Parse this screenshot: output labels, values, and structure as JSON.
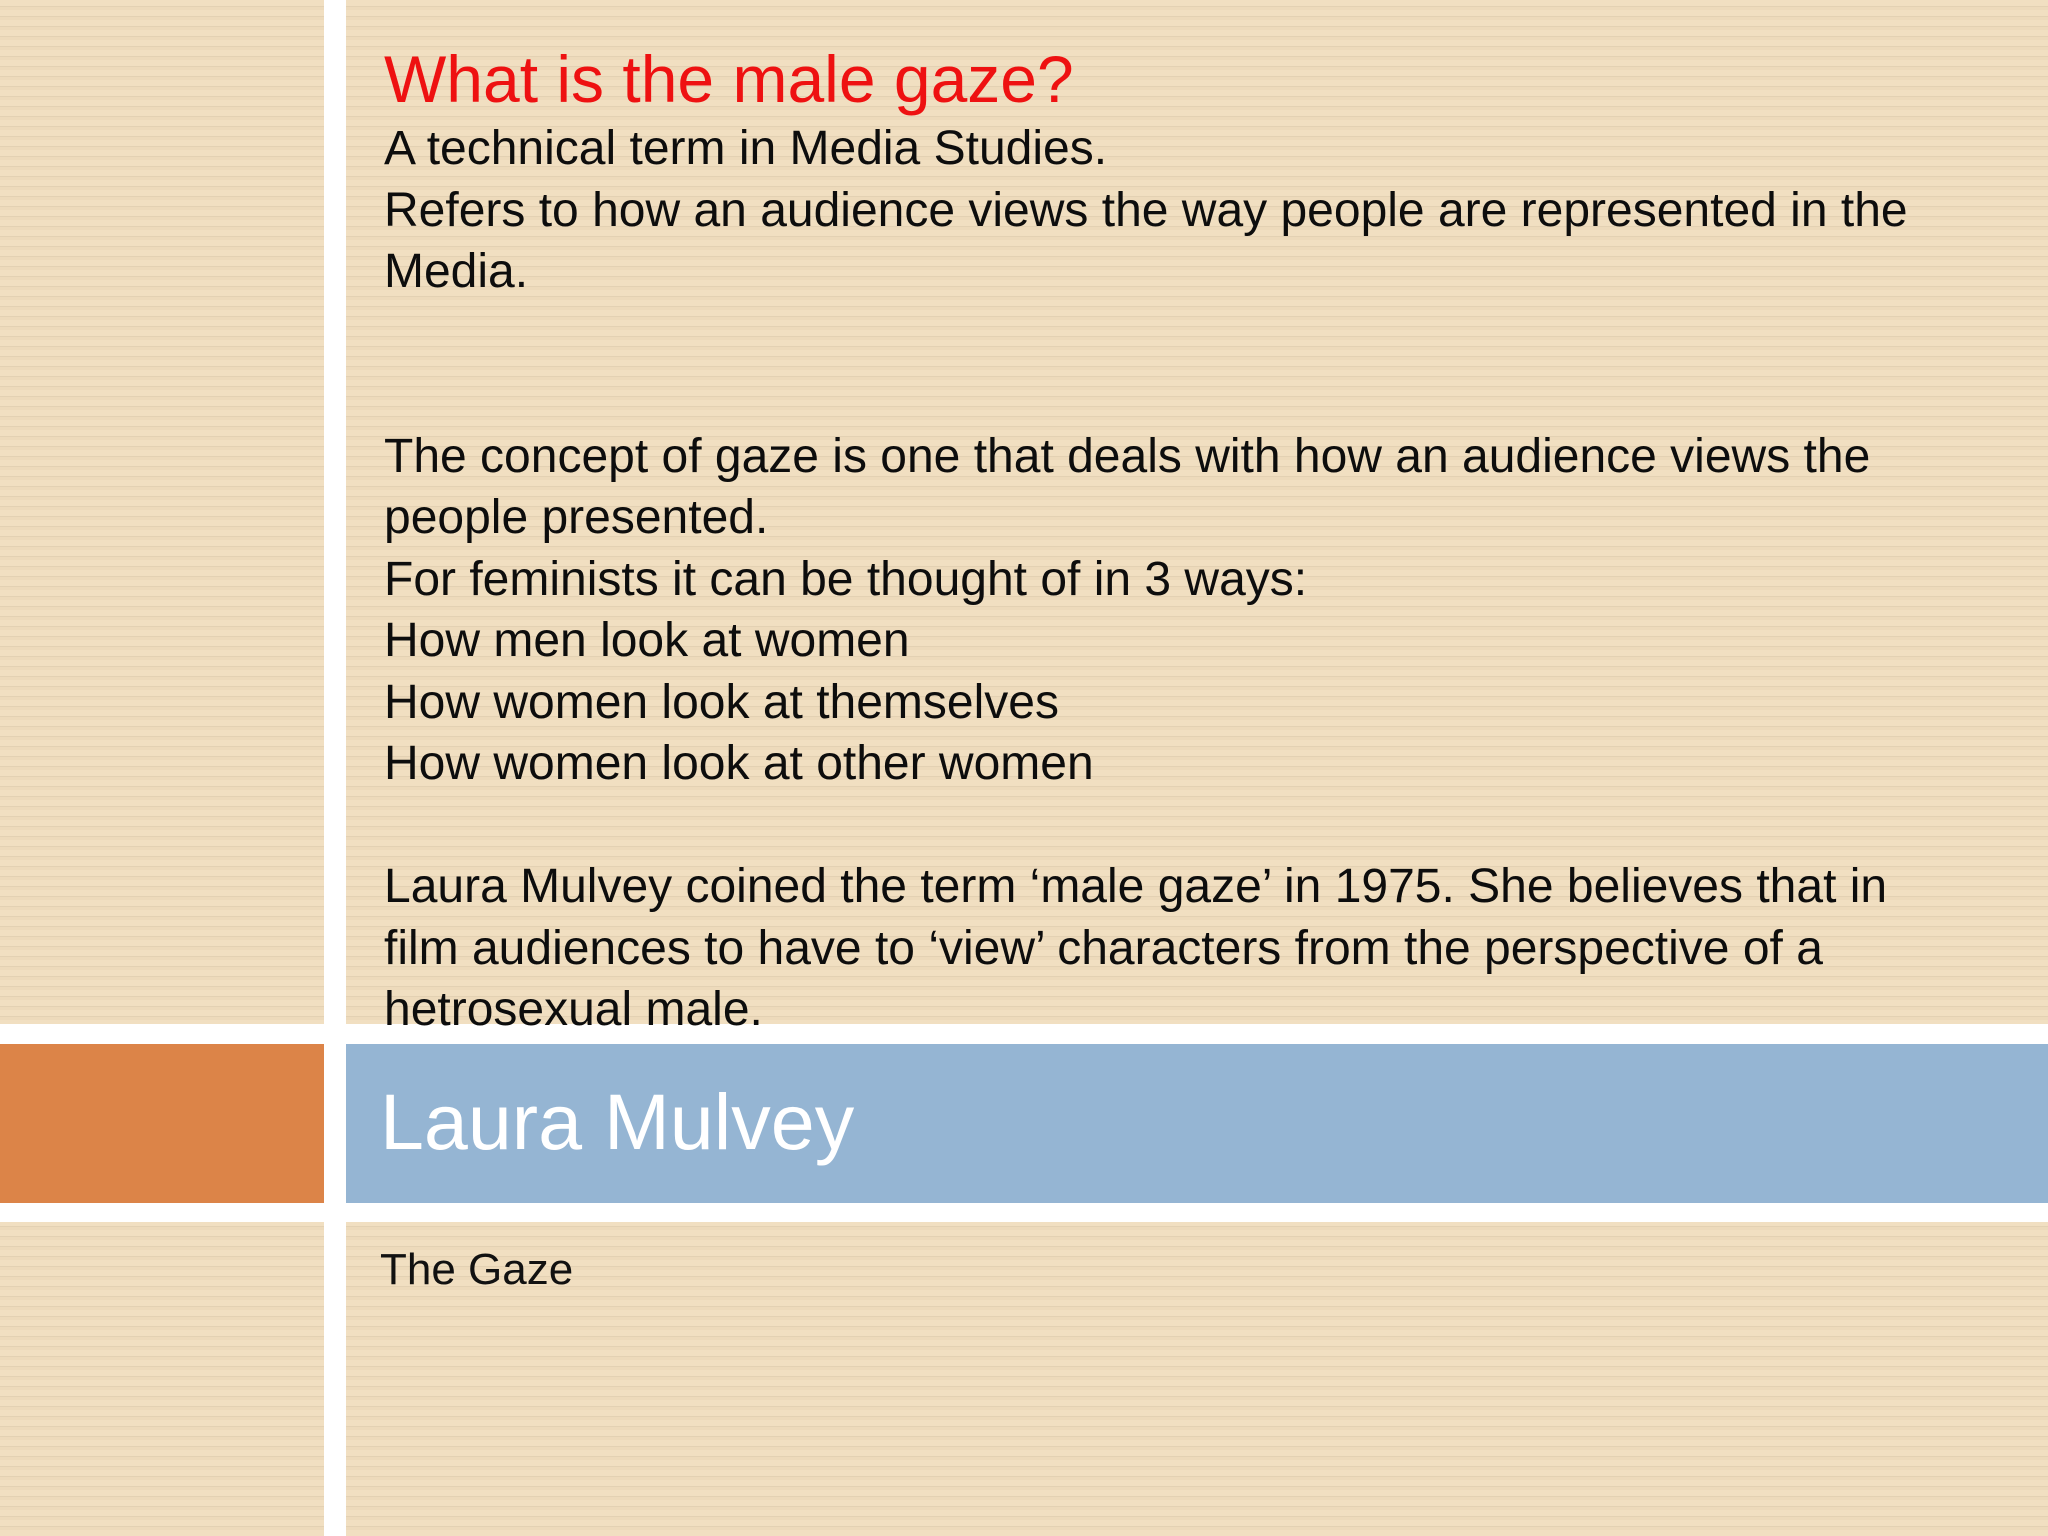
{
  "slide": {
    "heading": "What is the male gaze?",
    "paragraphs": [
      "A technical term in Media Studies.",
      "Refers to how an audience views the way people are represented in the",
      "Media.",
      "The concept of gaze is one that deals with how an audience views the",
      "people presented.",
      "For feminists it can be thought of in 3 ways:",
      "How men look at women",
      "How women look at themselves",
      "How women look at other women",
      "Laura Mulvey coined the term ‘male gaze’ in 1975. She believes that in",
      "film audiences to have to ‘view’ characters from the perspective of a",
      "hetrosexual male."
    ]
  },
  "band": {
    "title": "Laura Mulvey",
    "subtitle": "The Gaze"
  },
  "colors": {
    "heading": "#ee1111",
    "band": "#95b5d3",
    "accent": "#dc8448",
    "background": "#efdcbc"
  }
}
